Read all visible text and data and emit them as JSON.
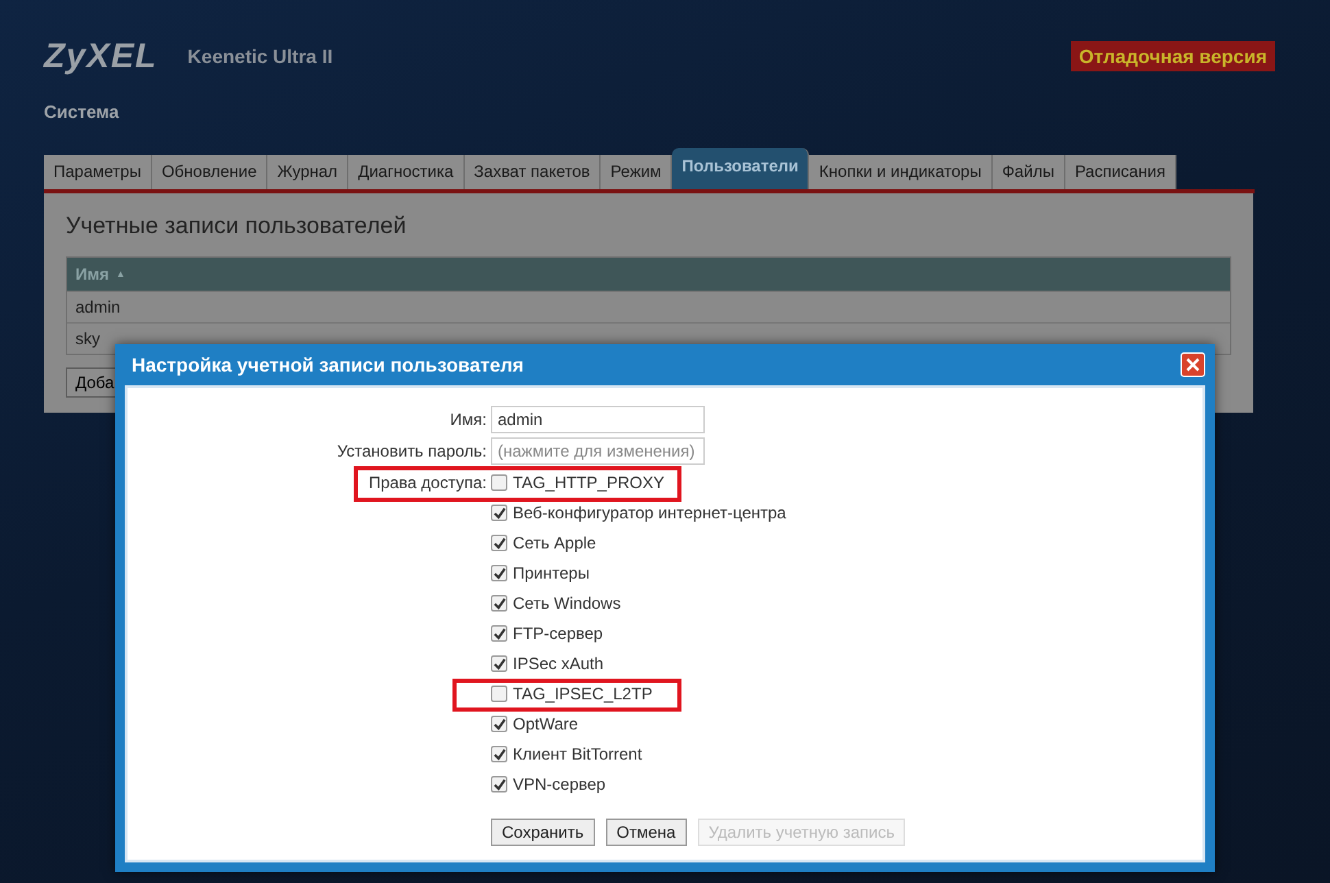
{
  "header": {
    "logo": "ZyXEL",
    "model": "Keenetic Ultra II",
    "badge": "Отладочная версия",
    "section": "Система"
  },
  "tabs": [
    {
      "label": "Параметры",
      "selected": false
    },
    {
      "label": "Обновление",
      "selected": false
    },
    {
      "label": "Журнал",
      "selected": false
    },
    {
      "label": "Диагностика",
      "selected": false
    },
    {
      "label": "Захват пакетов",
      "selected": false
    },
    {
      "label": "Режим",
      "selected": false
    },
    {
      "label": "Пользователи",
      "selected": true
    },
    {
      "label": "Кнопки и индикаторы",
      "selected": false
    },
    {
      "label": "Файлы",
      "selected": false
    },
    {
      "label": "Расписания",
      "selected": false
    }
  ],
  "panel": {
    "title": "Учетные записи пользователей",
    "column": "Имя",
    "sort_icon": "▲",
    "rows": [
      "admin",
      "sky"
    ],
    "add_button": "Доба"
  },
  "dialog": {
    "title": "Настройка учетной записи пользователя",
    "name_label": "Имя:",
    "name_value": "admin",
    "password_label": "Установить пароль:",
    "password_placeholder": "(нажмите для изменения)",
    "permissions_label": "Права доступа:",
    "permissions": [
      {
        "label": "TAG_HTTP_PROXY",
        "checked": false,
        "highlighted": true
      },
      {
        "label": "Веб-конфигуратор интернет-центра",
        "checked": true,
        "highlighted": false
      },
      {
        "label": "Сеть Apple",
        "checked": true,
        "highlighted": false
      },
      {
        "label": "Принтеры",
        "checked": true,
        "highlighted": false
      },
      {
        "label": "Сеть Windows",
        "checked": true,
        "highlighted": false
      },
      {
        "label": "FTP-сервер",
        "checked": true,
        "highlighted": false
      },
      {
        "label": "IPSec xAuth",
        "checked": true,
        "highlighted": false
      },
      {
        "label": "TAG_IPSEC_L2TP",
        "checked": false,
        "highlighted": true
      },
      {
        "label": "OptWare",
        "checked": true,
        "highlighted": false
      },
      {
        "label": "Клиент BitTorrent",
        "checked": true,
        "highlighted": false
      },
      {
        "label": "VPN-сервер",
        "checked": true,
        "highlighted": false
      }
    ],
    "buttons": [
      {
        "label": "Сохранить",
        "disabled": false
      },
      {
        "label": "Отмена",
        "disabled": false
      },
      {
        "label": "Удалить учетную запись",
        "disabled": true
      }
    ]
  }
}
